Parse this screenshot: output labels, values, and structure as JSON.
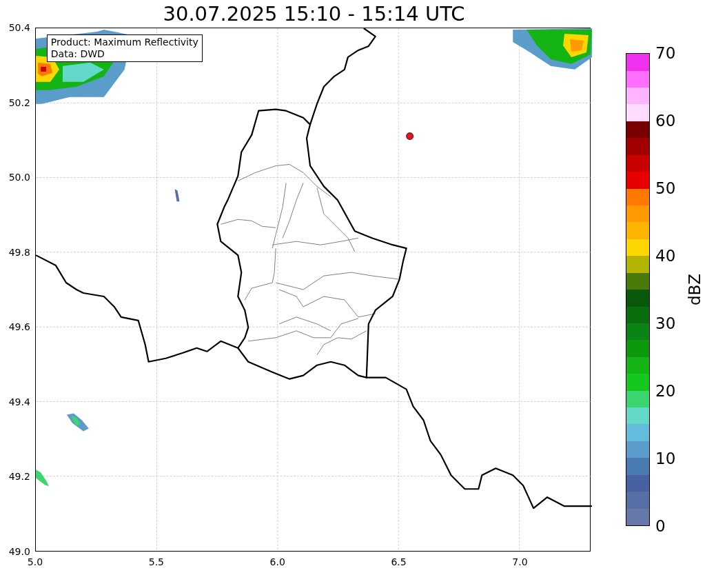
{
  "title": "30.07.2025 15:10 - 15:14 UTC",
  "map": {
    "legend": [
      "Product: Maximum Reflectivity",
      "Data: DWD"
    ],
    "xticks": [
      "5.0",
      "5.5",
      "6.0",
      "6.5",
      "7.0"
    ],
    "yticks": [
      "50.4",
      "50.2",
      "50.0",
      "49.8",
      "49.6",
      "49.4",
      "49.2",
      "49.0"
    ]
  },
  "colorbar": {
    "label": "dBZ",
    "ticks": [
      "70",
      "60",
      "50",
      "40",
      "30",
      "20",
      "10",
      "0"
    ],
    "segments": [
      {
        "color": "#6678a8"
      },
      {
        "color": "#5670a6"
      },
      {
        "color": "#4662a2"
      },
      {
        "color": "#4a7ab2"
      },
      {
        "color": "#5a9cca"
      },
      {
        "color": "#64bcdc"
      },
      {
        "color": "#64d8c8"
      },
      {
        "color": "#3cd66e"
      },
      {
        "color": "#14c81e"
      },
      {
        "color": "#14b414"
      },
      {
        "color": "#0c9a0c"
      },
      {
        "color": "#0a8414"
      },
      {
        "color": "#0a6e0c"
      },
      {
        "color": "#085a0a"
      },
      {
        "color": "#4a7a0a"
      },
      {
        "color": "#b4b404"
      },
      {
        "color": "#ffd700"
      },
      {
        "color": "#ffb400"
      },
      {
        "color": "#ff9a00"
      },
      {
        "color": "#ff7800"
      },
      {
        "color": "#e60000"
      },
      {
        "color": "#c80000"
      },
      {
        "color": "#a00000"
      },
      {
        "color": "#780000"
      },
      {
        "color": "#ffdcff"
      },
      {
        "color": "#ffb4ff"
      },
      {
        "color": "#ff6eff"
      },
      {
        "color": "#f032f0"
      }
    ]
  }
}
